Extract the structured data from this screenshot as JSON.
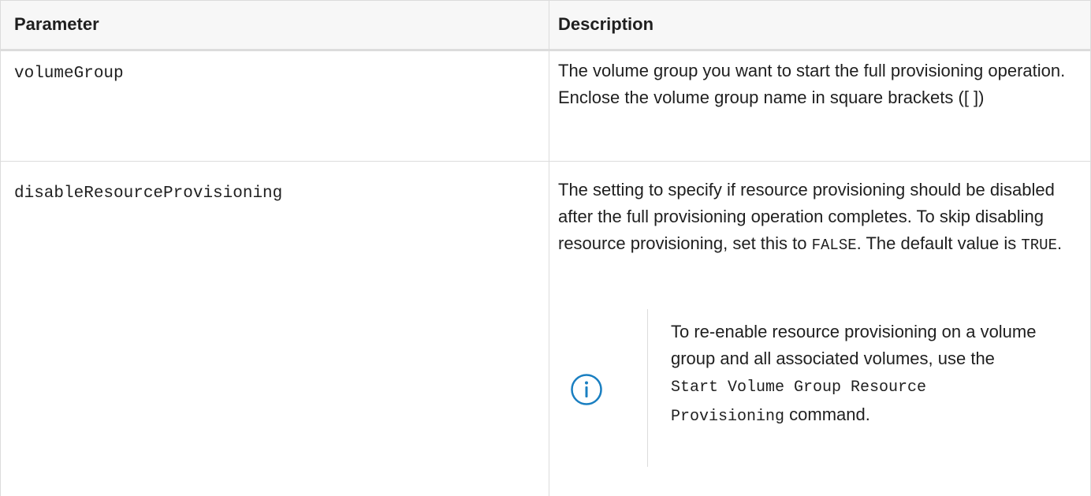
{
  "table": {
    "headers": {
      "parameter": "Parameter",
      "description": "Description"
    },
    "rows": [
      {
        "parameter": "volumeGroup",
        "description": "The volume group you want to start the full provisioning operation. Enclose the volume group name in square brackets ([ ])"
      },
      {
        "parameter": "disableResourceProvisioning",
        "description_part1": "The setting to specify if resource provisioning should be disabled after the full provisioning operation completes. To skip disabling resource provisioning, set this to ",
        "false_value": "FALSE",
        "description_part2": ". The default value is ",
        "true_value": "TRUE",
        "description_part3": ".",
        "note": {
          "icon": "info-circle-icon",
          "text_part1": "To re-enable resource provisioning on a volume group and all associated volumes, use the ",
          "command": "Start Volume Group Resource Provisioning",
          "text_part2": " command."
        }
      }
    ]
  },
  "colors": {
    "text": "#1f1f1f",
    "border": "#dcdcdc",
    "header_bg": "#f7f7f7",
    "info_icon": "#1a7fc1"
  }
}
